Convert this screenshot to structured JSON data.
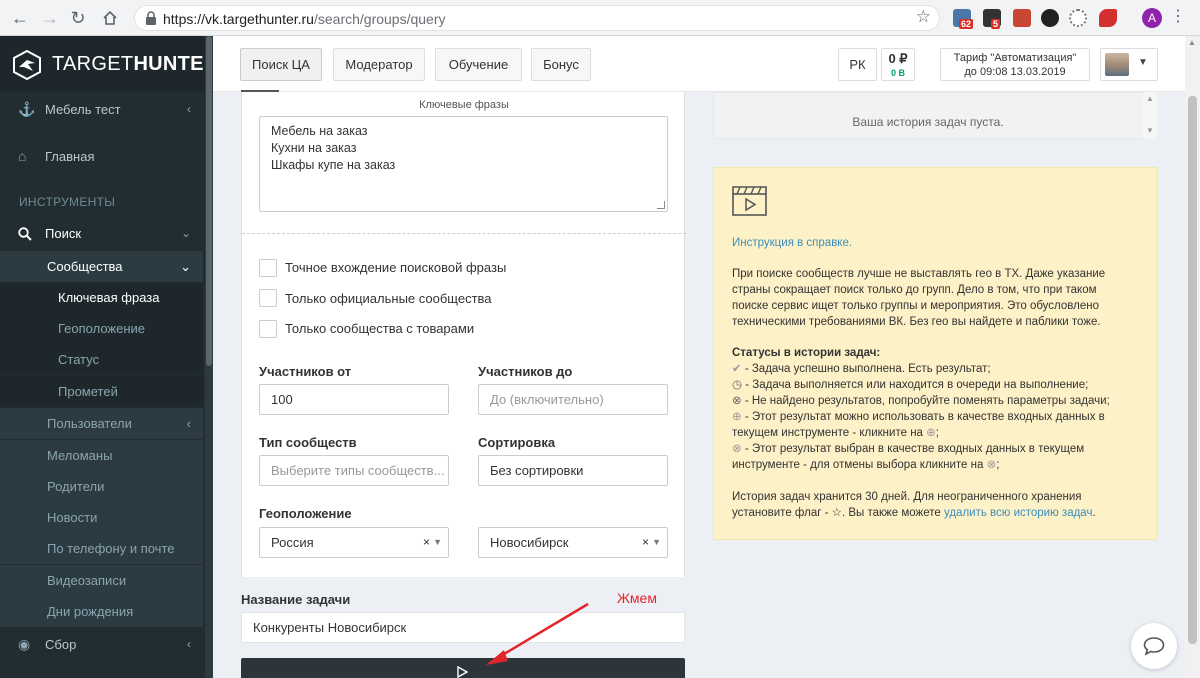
{
  "browser": {
    "url_host": "https://vk.targethunter.ru",
    "url_path": "/search/groups/query",
    "badge_1": "62",
    "badge_2": "5",
    "profile_letter": "A"
  },
  "brand": {
    "prefix": "TARGET",
    "suffix": "HUNTER"
  },
  "sidebar": {
    "project": "Мебель тест",
    "home": "Главная",
    "section_header": "ИНСТРУМЕНТЫ",
    "search": "Поиск",
    "communities": "Сообщества",
    "sub_items": [
      "Ключевая фраза",
      "Геоположение",
      "Статус",
      "Прометей"
    ],
    "items": [
      "Пользователи",
      "Меломаны",
      "Родители",
      "Новости",
      "По телефону и почте",
      "Видеозаписи",
      "Дни рождения"
    ],
    "collect": "Сбор"
  },
  "topbar": {
    "tabs": [
      "Поиск ЦА",
      "Модератор",
      "Обучение",
      "Бонус"
    ],
    "rk": "РК",
    "balance": "0 ₽",
    "balance_bonus": "0 В",
    "tariff_line1": "Тариф \"Автоматизация\"",
    "tariff_line2": "до 09:08 13.03.2019"
  },
  "form": {
    "keywords_title": "Ключевые фразы",
    "keywords": [
      "Мебель на заказ",
      "Кухни на заказ",
      "Шкафы купе на заказ"
    ],
    "checkboxes": [
      "Точное вхождение поисковой фразы",
      "Только официальные сообщества",
      "Только сообщества с товарами"
    ],
    "members_from_label": "Участников от",
    "members_from_value": "100",
    "members_to_label": "Участников до",
    "members_to_placeholder": "До (включительно)",
    "type_label": "Тип сообществ",
    "type_placeholder": "Выберите типы сообществ...",
    "sort_label": "Сортировка",
    "sort_value": "Без сортировки",
    "geo_label": "Геоположение",
    "geo_country": "Россия",
    "geo_city": "Новосибирск",
    "task_name_label": "Название задачи",
    "task_name_value": "Конкуренты Новосибирск"
  },
  "annotation": "Жмем",
  "history": {
    "empty": "Ваша история задач пуста."
  },
  "info": {
    "help_link": "Инструкция в справке.",
    "geo_tip": "При поиске сообществ лучше не выставлять гео в ТХ. Даже указание страны сокращает поиск только до групп. Дело в том, что при таком поиске сервис ищет только группы и мероприятия. Это обусловлено техническими требованиями ВК. Без гео вы найдете и паблики тоже.",
    "statuses_title": "Статусы в истории задач:",
    "status_1": " - Задача успешно выполнена. Есть результат;",
    "status_2": " - Задача выполняется или находится в очереди на выполнение;",
    "status_3": " - Не найдено результатов, попробуйте поменять параметры задачи;",
    "status_4a": " - Этот результат можно использовать в качестве входных данных в текущем инструменте - кликните на",
    "status_4b": ";",
    "status_5a": " - Этот результат выбран в качестве входных данных в текущем инструменте - для отмены выбора кликните на",
    "status_5b": ";",
    "storage_text": "История задач хранится 30 дней. Для неограниченного хранения установите флаг -",
    "storage_text2": ". Вы также можете",
    "delete_link": "удалить всю историю задач",
    "storage_end": "."
  }
}
